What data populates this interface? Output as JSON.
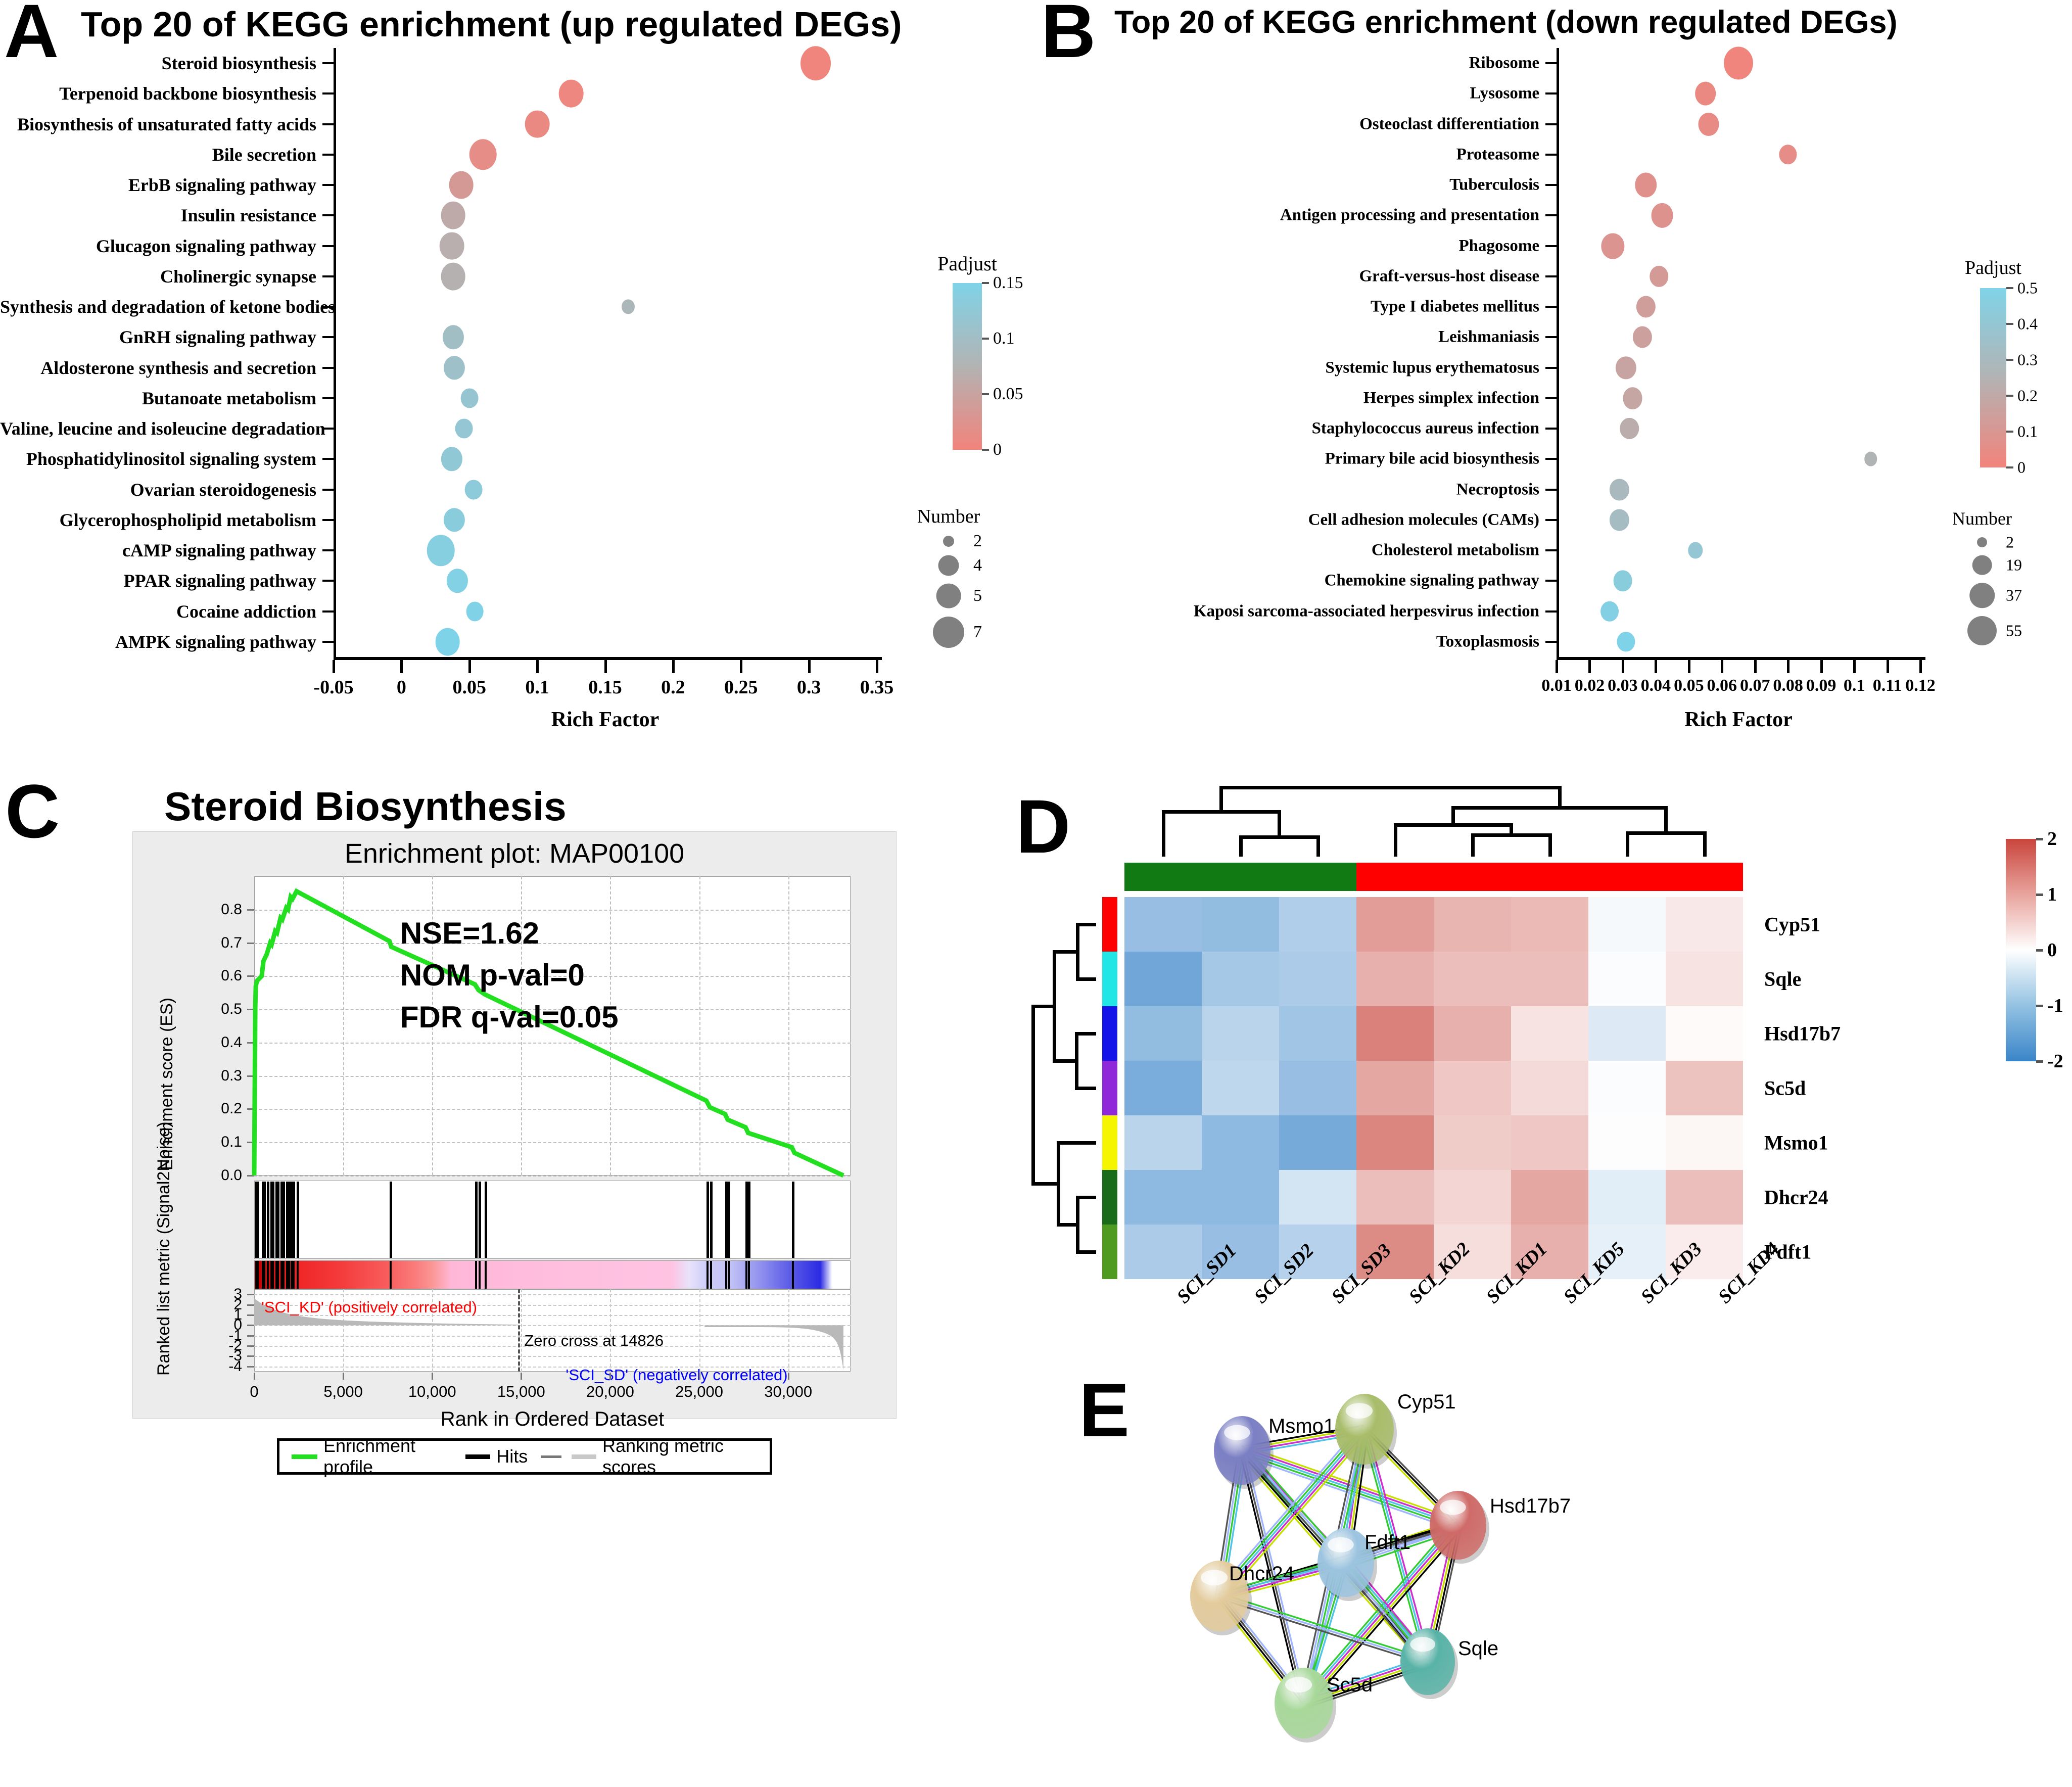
{
  "panelA": {
    "letter": "A",
    "title": "Top 20 of KEGG enrichment (up regulated DEGs)",
    "xlabel": "Rich Factor",
    "legend_color_title": "Padjust",
    "legend_size_title": "Number"
  },
  "panelB": {
    "letter": "B",
    "title": "Top 20 of KEGG enrichment (down regulated DEGs)",
    "xlabel": "Rich Factor",
    "legend_color_title": "Padjust",
    "legend_size_title": "Number"
  },
  "panelC": {
    "letter": "C",
    "title": "Steroid Biosynthesis",
    "subtitle": "Enrichment plot: MAP00100",
    "ylabel_top": "Enrichment score (ES)",
    "ylabel_bottom": "Ranked list metric (Signal2Noise)",
    "xlabel": "Rank in Ordered Dataset",
    "stats": [
      "NSE=1.62",
      "NOM p-val=0",
      "FDR q-val=0.05"
    ],
    "pos_corr_label": "'SCI_KD' (positively correlated)",
    "neg_corr_label": "'SCI_SD' (negatively correlated)",
    "zero_cross_label": "Zero cross at 14826",
    "legend": [
      "Enrichment profile",
      "Hits",
      "Ranking metric scores"
    ],
    "pos_corr_color": "#ff0000",
    "neg_corr_color": "#0000ff",
    "profile_color": "#22e020"
  },
  "panelD": {
    "letter": "D",
    "colorbar_ticks": [
      "2",
      "1",
      "0",
      "-1",
      "-2"
    ],
    "group_colors": [
      "#127a12",
      "#fe0000"
    ],
    "row_marker_colors": [
      "#fe0000",
      "#22e5e5",
      "#1414e8",
      "#8f28d8",
      "#f5f500",
      "#1a6b1a",
      "#4f9a20"
    ]
  },
  "panelE": {
    "letter": "E",
    "nodes": [
      {
        "label": "Msmo1",
        "color": "#7b7fc4"
      },
      {
        "label": "Cyp51",
        "color": "#a8bd6a"
      },
      {
        "label": "Hsd17b7",
        "color": "#cf6b68"
      },
      {
        "label": "Fdft1",
        "color": "#9cc4e0"
      },
      {
        "label": "Dhcr24",
        "color": "#e3cb9c"
      },
      {
        "label": "Sqle",
        "color": "#59b3a7"
      },
      {
        "label": "Sc5d",
        "color": "#a8d89a"
      }
    ]
  },
  "chart_data": [
    {
      "type": "scatter",
      "panel": "A",
      "title": "Top 20 of KEGG enrichment (up regulated DEGs)",
      "xlabel": "Rich Factor",
      "ylabel": "",
      "xlim": [
        -0.05,
        0.35
      ],
      "xticks": [
        "-0.05",
        "0",
        "0.05",
        "0.1",
        "0.15",
        "0.2",
        "0.25",
        "0.3",
        "0.35"
      ],
      "xtickvals": [
        -0.05,
        0,
        0.05,
        0.1,
        0.15,
        0.2,
        0.25,
        0.3,
        0.35
      ],
      "color_legend": {
        "title": "Padjust",
        "ticks": [
          "0.15",
          "0.1",
          "0.05",
          "0"
        ],
        "tickvals": [
          0.15,
          0.1,
          0.05,
          0
        ],
        "low_color": "#f2837b",
        "high_color": "#7fd3e8"
      },
      "size_legend": {
        "title": "Number",
        "values": [
          2,
          4,
          5,
          7
        ]
      },
      "categories": [
        "Steroid biosynthesis",
        "Terpenoid backbone biosynthesis",
        "Biosynthesis of unsaturated fatty acids",
        "Bile secretion",
        "ErbB signaling pathway",
        "Insulin resistance",
        "Glucagon signaling pathway",
        "Cholinergic synapse",
        "Synthesis and degradation of ketone bodies",
        "GnRH signaling pathway",
        "Aldosterone synthesis and secretion",
        "Butanoate metabolism",
        "Valine, leucine and isoleucine degradation",
        "Phosphatidylinositol signaling system",
        "Ovarian steroidogenesis",
        "Glycerophospholipid metabolism",
        "cAMP signaling pathway",
        "PPAR signaling pathway",
        "Cocaine addiction",
        "AMPK signaling pathway"
      ],
      "points": [
        {
          "category": "Steroid biosynthesis",
          "rich_factor": 0.305,
          "padjust": 0.003,
          "number": 7
        },
        {
          "category": "Terpenoid backbone biosynthesis",
          "rich_factor": 0.125,
          "padjust": 0.006,
          "number": 5
        },
        {
          "category": "Biosynthesis of unsaturated fatty acids",
          "rich_factor": 0.1,
          "padjust": 0.01,
          "number": 5
        },
        {
          "category": "Bile secretion",
          "rich_factor": 0.06,
          "padjust": 0.015,
          "number": 6
        },
        {
          "category": "ErbB signaling pathway",
          "rich_factor": 0.044,
          "padjust": 0.035,
          "number": 5
        },
        {
          "category": "Insulin resistance",
          "rich_factor": 0.038,
          "padjust": 0.062,
          "number": 5
        },
        {
          "category": "Glucagon signaling pathway",
          "rich_factor": 0.037,
          "padjust": 0.068,
          "number": 5
        },
        {
          "category": "Cholinergic synapse",
          "rich_factor": 0.038,
          "padjust": 0.072,
          "number": 5
        },
        {
          "category": "Synthesis and degradation of ketone bodies",
          "rich_factor": 0.167,
          "padjust": 0.085,
          "number": 2
        },
        {
          "category": "GnRH signaling pathway",
          "rich_factor": 0.038,
          "padjust": 0.1,
          "number": 4
        },
        {
          "category": "Aldosterone synthesis and secretion",
          "rich_factor": 0.039,
          "padjust": 0.105,
          "number": 4
        },
        {
          "category": "Butanoate metabolism",
          "rich_factor": 0.05,
          "padjust": 0.118,
          "number": 3
        },
        {
          "category": "Valine, leucine and isoleucine degradation",
          "rich_factor": 0.046,
          "padjust": 0.12,
          "number": 3
        },
        {
          "category": "Phosphatidylinositol signaling system",
          "rich_factor": 0.037,
          "padjust": 0.125,
          "number": 4
        },
        {
          "category": "Ovarian steroidogenesis",
          "rich_factor": 0.053,
          "padjust": 0.13,
          "number": 3
        },
        {
          "category": "Glycerophospholipid metabolism",
          "rich_factor": 0.039,
          "padjust": 0.135,
          "number": 4
        },
        {
          "category": "cAMP signaling pathway",
          "rich_factor": 0.029,
          "padjust": 0.14,
          "number": 6
        },
        {
          "category": "PPAR signaling pathway",
          "rich_factor": 0.041,
          "padjust": 0.145,
          "number": 4
        },
        {
          "category": "Cocaine addiction",
          "rich_factor": 0.054,
          "padjust": 0.148,
          "number": 3
        },
        {
          "category": "AMPK signaling pathway",
          "rich_factor": 0.034,
          "padjust": 0.15,
          "number": 5
        }
      ]
    },
    {
      "type": "scatter",
      "panel": "B",
      "title": "Top 20 of KEGG enrichment (down regulated DEGs)",
      "xlabel": "Rich Factor",
      "ylabel": "",
      "xlim": [
        0.01,
        0.12
      ],
      "xticks": [
        "0.01",
        "0.02",
        "0.03",
        "0.04",
        "0.05",
        "0.06",
        "0.07",
        "0.08",
        "0.09",
        "0.1",
        "0.11",
        "0.12"
      ],
      "xtickvals": [
        0.01,
        0.02,
        0.03,
        0.04,
        0.05,
        0.06,
        0.07,
        0.08,
        0.09,
        0.1,
        0.11,
        0.12
      ],
      "color_legend": {
        "title": "Padjust",
        "ticks": [
          "0.5",
          "0.4",
          "0.3",
          "0.2",
          "0.1",
          "0"
        ],
        "tickvals": [
          0.5,
          0.4,
          0.3,
          0.2,
          0.1,
          0
        ],
        "low_color": "#f2837b",
        "high_color": "#7fd3e8"
      },
      "size_legend": {
        "title": "Number",
        "values": [
          2,
          19,
          37,
          55
        ]
      },
      "categories": [
        "Ribosome",
        "Lysosome",
        "Osteoclast differentiation",
        "Proteasome",
        "Tuberculosis",
        "Antigen processing and presentation",
        "Phagosome",
        "Graft-versus-host disease",
        "Type I diabetes mellitus",
        "Leishmaniasis",
        "Systemic lupus erythematosus",
        "Herpes simplex infection",
        "Staphylococcus aureus infection",
        "Primary bile acid biosynthesis",
        "Necroptosis",
        "Cell adhesion molecules (CAMs)",
        "Cholesterol metabolism",
        "Chemokine signaling pathway",
        "Kaposi sarcoma-associated herpesvirus infection",
        "Toxoplasmosis"
      ],
      "points": [
        {
          "category": "Ribosome",
          "rich_factor": 0.065,
          "padjust": 0.01,
          "number": 55
        },
        {
          "category": "Lysosome",
          "rich_factor": 0.055,
          "padjust": 0.03,
          "number": 22
        },
        {
          "category": "Osteoclast differentiation",
          "rich_factor": 0.056,
          "padjust": 0.04,
          "number": 21
        },
        {
          "category": "Proteasome",
          "rich_factor": 0.08,
          "padjust": 0.05,
          "number": 13
        },
        {
          "category": "Tuberculosis",
          "rich_factor": 0.037,
          "padjust": 0.07,
          "number": 25
        },
        {
          "category": "Antigen processing and presentation",
          "rich_factor": 0.042,
          "padjust": 0.08,
          "number": 24
        },
        {
          "category": "Phagosome",
          "rich_factor": 0.027,
          "padjust": 0.09,
          "number": 28
        },
        {
          "category": "Graft-versus-host disease",
          "rich_factor": 0.041,
          "padjust": 0.12,
          "number": 16
        },
        {
          "category": "Type I diabetes mellitus",
          "rich_factor": 0.037,
          "padjust": 0.14,
          "number": 17
        },
        {
          "category": "Leishmaniasis",
          "rich_factor": 0.036,
          "padjust": 0.15,
          "number": 17
        },
        {
          "category": "Systemic lupus erythematosus",
          "rich_factor": 0.031,
          "padjust": 0.17,
          "number": 20
        },
        {
          "category": "Herpes simplex infection",
          "rich_factor": 0.033,
          "padjust": 0.18,
          "number": 18
        },
        {
          "category": "Staphylococcus aureus infection",
          "rich_factor": 0.032,
          "padjust": 0.22,
          "number": 16
        },
        {
          "category": "Primary bile acid biosynthesis",
          "rich_factor": 0.105,
          "padjust": 0.26,
          "number": 4
        },
        {
          "category": "Necroptosis",
          "rich_factor": 0.029,
          "padjust": 0.3,
          "number": 17
        },
        {
          "category": "Cell adhesion molecules (CAMs)",
          "rich_factor": 0.029,
          "padjust": 0.32,
          "number": 17
        },
        {
          "category": "Cholesterol metabolism",
          "rich_factor": 0.052,
          "padjust": 0.4,
          "number": 7
        },
        {
          "category": "Chemokine signaling pathway",
          "rich_factor": 0.03,
          "padjust": 0.45,
          "number": 15
        },
        {
          "category": "Kaposi sarcoma-associated herpesvirus infection",
          "rich_factor": 0.026,
          "padjust": 0.48,
          "number": 14
        },
        {
          "category": "Toxoplasmosis",
          "rich_factor": 0.031,
          "padjust": 0.5,
          "number": 13
        }
      ]
    },
    {
      "type": "line",
      "panel": "C",
      "title": "Enrichment plot: MAP00100",
      "xlabel": "Rank in Ordered Dataset",
      "ylabel": "Enrichment score (ES)",
      "xlim": [
        0,
        33500
      ],
      "ylim_es": [
        0.0,
        0.9
      ],
      "yticks_es": [
        "0.0",
        "0.1",
        "0.2",
        "0.3",
        "0.4",
        "0.5",
        "0.6",
        "0.7",
        "0.8"
      ],
      "ylim_metric": [
        -4.5,
        3.5
      ],
      "yticks_metric": [
        "3",
        "2",
        "1",
        "0",
        "-1",
        "-2",
        "-3",
        "-4"
      ],
      "xticks": [
        "0",
        "5,000",
        "10,000",
        "15,000",
        "20,000",
        "25,000",
        "30,000"
      ],
      "xtickvals": [
        0,
        5000,
        10000,
        15000,
        20000,
        25000,
        30000
      ],
      "zero_cross": 14826,
      "es_curve": [
        [
          0,
          0.0
        ],
        [
          60,
          0.51
        ],
        [
          90,
          0.57
        ],
        [
          150,
          0.585
        ],
        [
          420,
          0.6
        ],
        [
          520,
          0.645
        ],
        [
          700,
          0.665
        ],
        [
          900,
          0.7
        ],
        [
          980,
          0.695
        ],
        [
          1180,
          0.735
        ],
        [
          1280,
          0.73
        ],
        [
          1480,
          0.775
        ],
        [
          1580,
          0.77
        ],
        [
          1800,
          0.805
        ],
        [
          1900,
          0.8
        ],
        [
          2050,
          0.838
        ],
        [
          2150,
          0.832
        ],
        [
          2380,
          0.855
        ],
        [
          7600,
          0.705
        ],
        [
          7700,
          0.688
        ],
        [
          12400,
          0.575
        ],
        [
          12600,
          0.558
        ],
        [
          12950,
          0.545
        ],
        [
          25400,
          0.225
        ],
        [
          25600,
          0.205
        ],
        [
          26450,
          0.185
        ],
        [
          26600,
          0.168
        ],
        [
          27600,
          0.145
        ],
        [
          27750,
          0.128
        ],
        [
          30200,
          0.085
        ],
        [
          30350,
          0.068
        ],
        [
          33100,
          0.0
        ]
      ],
      "hits": [
        60,
        90,
        150,
        420,
        520,
        700,
        900,
        980,
        1180,
        1280,
        1480,
        1580,
        1800,
        1900,
        2050,
        2150,
        2380,
        7600,
        12400,
        12600,
        12950,
        25400,
        25600,
        26450,
        26600,
        27600,
        27750,
        30200
      ],
      "metric_curve_note": "decaying positive values to zero cross at 14826, negative tail from ~25300 to 33100"
    },
    {
      "type": "heatmap",
      "panel": "D",
      "rows": [
        "Cyp51",
        "Sqle",
        "Hsd17b7",
        "Sc5d",
        "Msmo1",
        "Dhcr24",
        "Fdft1"
      ],
      "columns": [
        "SCI_SD1",
        "SCI_SD2",
        "SCI_SD3",
        "SCI_KD2",
        "SCI_KD1",
        "SCI_KD5",
        "SCI_KD3",
        "SCI_KD4"
      ],
      "column_groups": [
        "SD",
        "SD",
        "SD",
        "KD",
        "KD",
        "KD",
        "KD",
        "KD"
      ],
      "zlim": [
        -2,
        2
      ],
      "colorbar_ticks": [
        2,
        1,
        0,
        -1,
        -2
      ],
      "values": [
        [
          -1.05,
          -1.1,
          -0.8,
          1.05,
          0.8,
          0.75,
          -0.1,
          0.25
        ],
        [
          -1.45,
          -0.9,
          -0.85,
          0.85,
          0.7,
          0.7,
          -0.05,
          0.3
        ],
        [
          -1.1,
          -0.7,
          -0.95,
          1.35,
          0.85,
          0.3,
          -0.35,
          0.05
        ],
        [
          -1.35,
          -0.65,
          -1.05,
          0.95,
          0.6,
          0.4,
          -0.05,
          0.65
        ],
        [
          -0.7,
          -1.15,
          -1.4,
          1.3,
          0.55,
          0.6,
          0.02,
          0.1
        ],
        [
          -1.15,
          -1.15,
          -0.45,
          0.7,
          0.45,
          0.95,
          -0.3,
          0.7
        ],
        [
          -0.85,
          -1.05,
          -0.75,
          1.25,
          0.35,
          0.85,
          -0.25,
          0.2
        ]
      ]
    },
    {
      "type": "network",
      "panel": "E",
      "nodes": [
        "Msmo1",
        "Cyp51",
        "Hsd17b7",
        "Fdft1",
        "Dhcr24",
        "Sqle",
        "Sc5d"
      ],
      "fully_connected": true
    }
  ]
}
